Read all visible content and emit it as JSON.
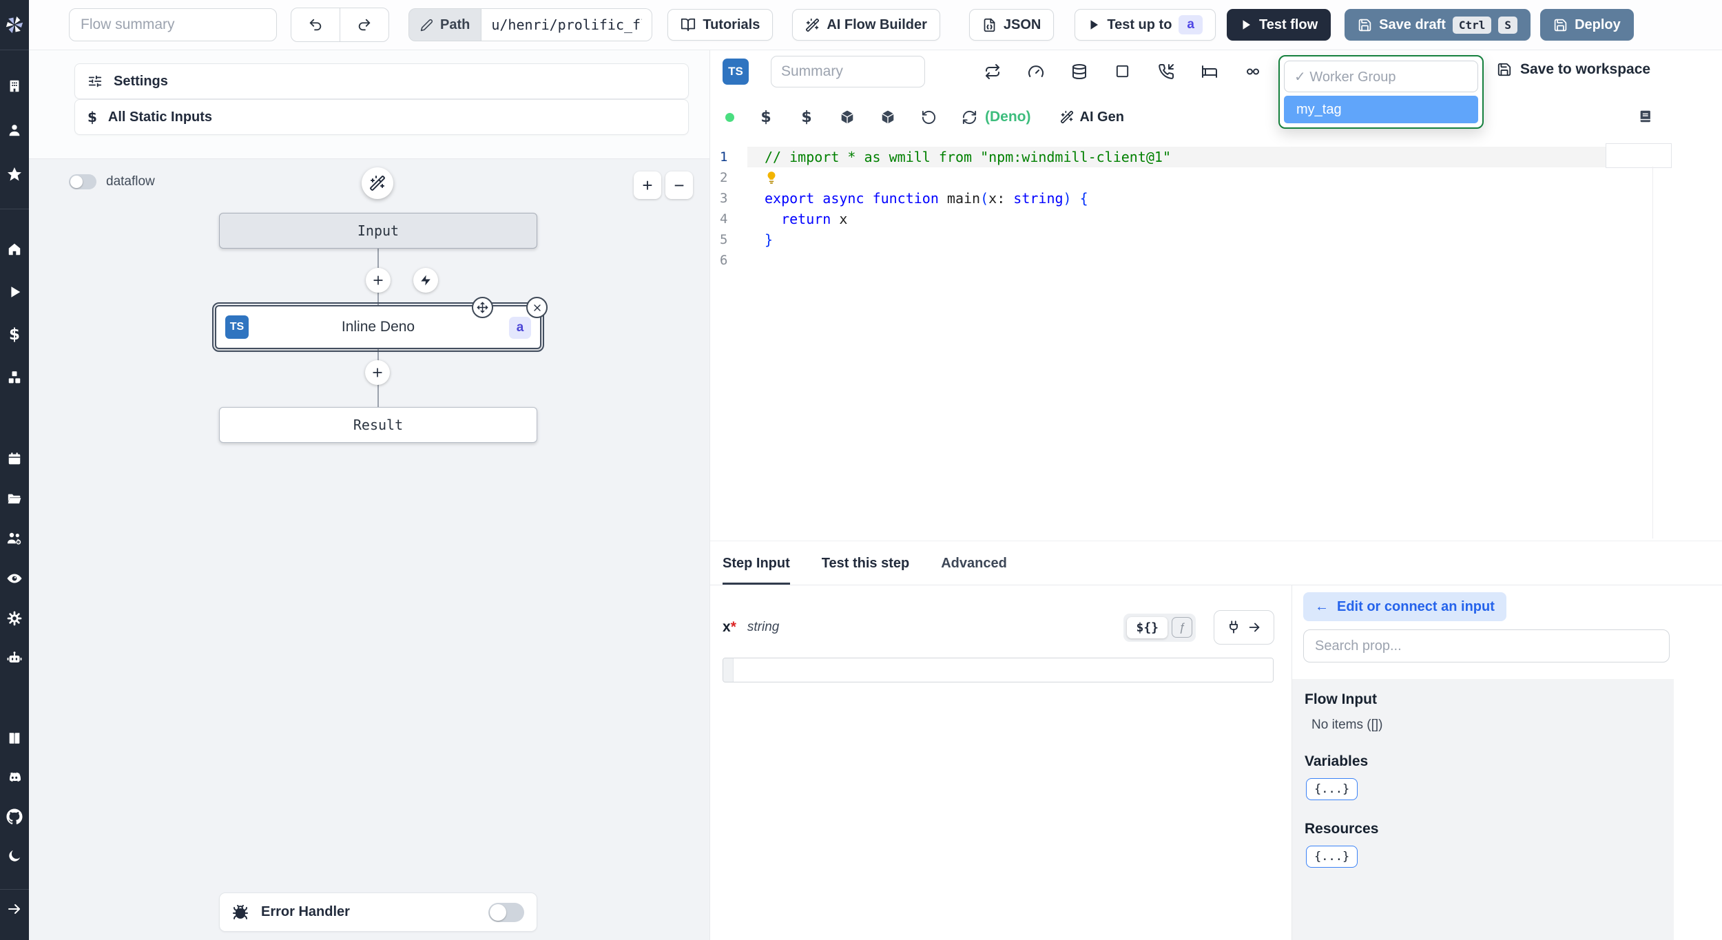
{
  "topbar": {
    "flow_summary_placeholder": "Flow summary",
    "path_label": "Path",
    "path_value": "u/henri/prolific_flow",
    "tutorials_label": "Tutorials",
    "ai_flow_builder_label": "AI Flow Builder",
    "json_label": "JSON",
    "test_up_to_label": "Test up to",
    "test_up_to_step": "a",
    "test_flow_label": "Test flow",
    "save_draft_label": "Save draft",
    "save_draft_kbd": [
      "Ctrl",
      "S"
    ],
    "deploy_label": "Deploy"
  },
  "sidebar": {
    "icons": [
      "windmill-logo",
      "workspace-building",
      "user",
      "favorites-star",
      "home",
      "runs-play",
      "variables-dollar",
      "resources-boxes",
      "schedules-calendar",
      "folders",
      "groups",
      "audit-logs-eye",
      "workspace-settings-gear",
      "workers-robot",
      "docs-book",
      "discord",
      "github",
      "dark-mode-moon",
      "expand-sidebar-arrow"
    ]
  },
  "glyphs": {
    "dollar": "$"
  },
  "flow_panel": {
    "settings_label": "Settings",
    "static_inputs_label": "All Static Inputs",
    "dataflow_label": "dataflow",
    "zoom_in": "+",
    "zoom_out": "−",
    "input_node_label": "Input",
    "step_node": {
      "lang_badge": "TS",
      "label": "Inline Deno",
      "id_badge": "a"
    },
    "result_node_label": "Result",
    "error_handler_label": "Error Handler"
  },
  "editor": {
    "lang_badge": "TS",
    "summary_placeholder": "Summary",
    "worker_group": {
      "header": "✓ Worker Group",
      "selected_option": "my_tag"
    },
    "save_to_workspace_label": "Save to workspace",
    "language_label": "(Deno)",
    "ai_gen_label": "AI Gen",
    "code": {
      "lines": [
        {
          "num": "1",
          "active": true,
          "tokens": [
            {
              "c": "cmt",
              "t": "// import * as wmill from \"npm:windmill-client@1\""
            }
          ]
        },
        {
          "num": "2",
          "lightbulb": true,
          "tokens": []
        },
        {
          "num": "3",
          "tokens": [
            {
              "c": "kw",
              "t": "export"
            },
            {
              "c": "pln",
              "t": " "
            },
            {
              "c": "kw",
              "t": "async"
            },
            {
              "c": "pln",
              "t": " "
            },
            {
              "c": "kw",
              "t": "function"
            },
            {
              "c": "pln",
              "t": " main"
            },
            {
              "c": "brk",
              "t": "("
            },
            {
              "c": "pln",
              "t": "x"
            },
            {
              "c": "pln",
              "t": ": "
            },
            {
              "c": "kw",
              "t": "string"
            },
            {
              "c": "brk",
              "t": ")"
            },
            {
              "c": "pln",
              "t": " "
            },
            {
              "c": "brk",
              "t": "{"
            }
          ]
        },
        {
          "num": "4",
          "tokens": [
            {
              "c": "pln",
              "t": "  "
            },
            {
              "c": "kw",
              "t": "return"
            },
            {
              "c": "pln",
              "t": " x"
            }
          ]
        },
        {
          "num": "5",
          "tokens": [
            {
              "c": "brk",
              "t": "}"
            }
          ]
        },
        {
          "num": "6",
          "tokens": []
        }
      ]
    }
  },
  "step_panel": {
    "tabs": [
      "Step Input",
      "Test this step",
      "Advanced"
    ],
    "active_tab": "Step Input",
    "field_name": "x",
    "required_mark": "*",
    "field_type": "string",
    "field_value": "",
    "expr_toggle_label": "${}",
    "fn_toggle_label": "ƒ"
  },
  "prop_picker": {
    "connect_arrow": "←",
    "connect_label": "Edit or connect an input",
    "search_placeholder": "Search prop...",
    "flow_input_title": "Flow Input",
    "flow_input_empty": "No items ([])",
    "variables_title": "Variables",
    "variables_chip": "{...}",
    "resources_title": "Resources",
    "resources_chip": "{...}"
  },
  "colors": {
    "sidebar_bg": "#212936",
    "accent_blue": "#2f74c0",
    "selected_tag_blue": "#60a5fa",
    "worker_group_green": "#15803d",
    "status_green": "#4ade80",
    "save_button_blue": "#5e7d9c",
    "dark_navy": "#222b3c"
  }
}
